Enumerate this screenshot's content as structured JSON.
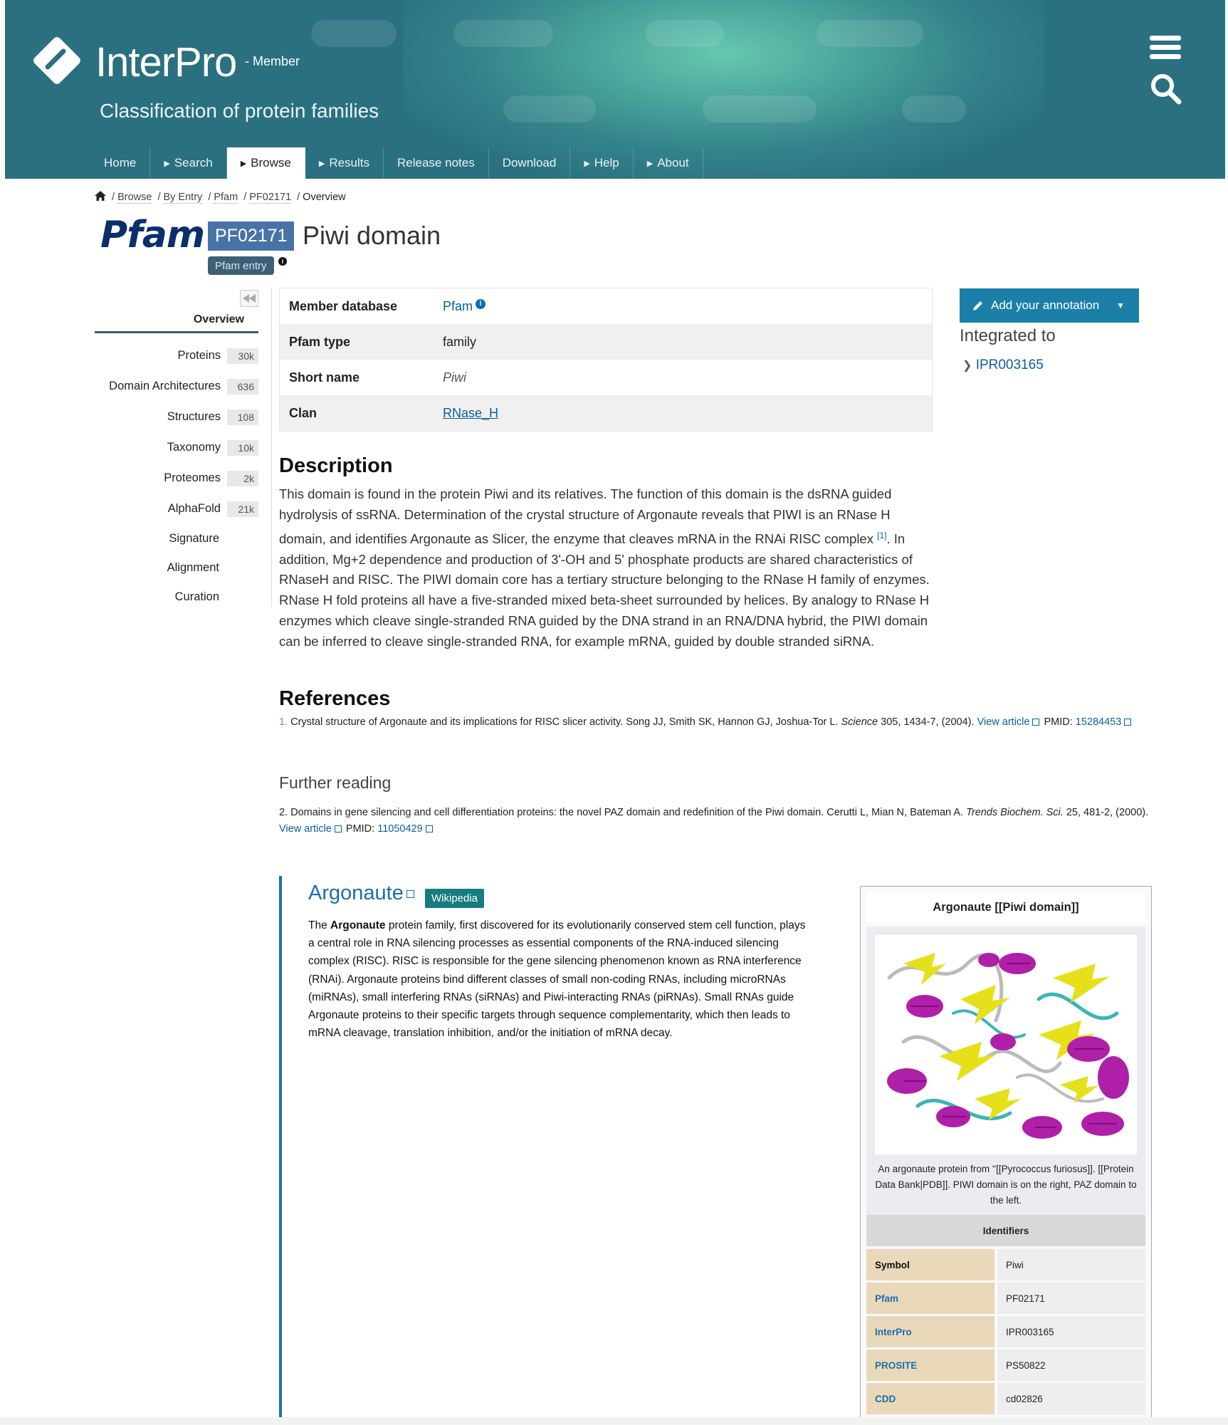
{
  "header": {
    "brand": "InterPro",
    "member_label": "- Member",
    "tagline": "Classification of protein families",
    "nav": [
      {
        "label": "Home",
        "caret": false,
        "active": false
      },
      {
        "label": "Search",
        "caret": true,
        "active": false
      },
      {
        "label": "Browse",
        "caret": true,
        "active": true
      },
      {
        "label": "Results",
        "caret": true,
        "active": false
      },
      {
        "label": "Release notes",
        "caret": false,
        "active": false
      },
      {
        "label": "Download",
        "caret": false,
        "active": false
      },
      {
        "label": "Help",
        "caret": true,
        "active": false
      },
      {
        "label": "About",
        "caret": true,
        "active": false
      }
    ]
  },
  "breadcrumb": [
    "Browse",
    "By Entry",
    "Pfam",
    "PF02171",
    "Overview"
  ],
  "entry": {
    "db_logo_text": "Pfam",
    "accession": "PF02171",
    "title": "Piwi domain",
    "type_badge": "Pfam entry"
  },
  "sidebar": {
    "active": "Overview",
    "items": [
      {
        "label": "Proteins",
        "count": "30k"
      },
      {
        "label": "Domain Architectures",
        "count": "636"
      },
      {
        "label": "Structures",
        "count": "108"
      },
      {
        "label": "Taxonomy",
        "count": "10k"
      },
      {
        "label": "Proteomes",
        "count": "2k"
      },
      {
        "label": "AlphaFold",
        "count": "21k"
      }
    ],
    "plain_items": [
      "Signature",
      "Alignment",
      "Curation"
    ]
  },
  "member_table": [
    {
      "key": "Member database",
      "value": "Pfam"
    },
    {
      "key": "Pfam type",
      "value": "family"
    },
    {
      "key": "Short name",
      "value": "Piwi"
    },
    {
      "key": "Clan",
      "value": "RNase_H"
    }
  ],
  "right": {
    "annotation_button": "Add your annotation",
    "integrated_heading": "Integrated to",
    "integrated_link": "IPR003165"
  },
  "description": {
    "heading": "Description",
    "text_before": "This domain is found in the protein Piwi and its relatives. The function of this domain is the dsRNA guided hydrolysis of ssRNA. Determination of the crystal structure of Argonaute reveals that PIWI is an RNase H domain, and identifies Argonaute as Slicer, the enzyme that cleaves mRNA in the RNAi RISC complex ",
    "citation": "[1]",
    "text_after": ". In addition, Mg+2 dependence and production of 3'-OH and 5' phosphate products are shared characteristics of RNaseH and RISC. The PIWI domain core has a tertiary structure belonging to the RNase H family of enzymes. RNase H fold proteins all have a five-stranded mixed beta-sheet surrounded by helices. By analogy to RNase H enzymes which cleave single-stranded RNA guided by the DNA strand in an RNA/DNA hybrid, the PIWI domain can be inferred to cleave single-stranded RNA, for example mRNA, guided by double stranded siRNA."
  },
  "references": {
    "heading": "References",
    "items": [
      {
        "num": "1.",
        "text": "Crystal structure of Argonaute and its implications for RISC slicer activity. Song JJ, Smith SK, Hannon GJ, Joshua-Tor L.",
        "journal": "Science",
        "details": "305, 1434-7, (2004).",
        "view_label": "View article",
        "pmid_label": "PMID:",
        "pmid": "15284453"
      }
    ]
  },
  "further_reading": {
    "heading": "Further reading",
    "items": [
      {
        "num": "2.",
        "text": "Domains in gene silencing and cell differentiation proteins: the novel PAZ domain and redefinition of the Piwi domain. Cerutti L, Mian N, Bateman A.",
        "journal": "Trends Biochem. Sci.",
        "details": "25, 481-2, (2000).",
        "view_label": "View article",
        "pmid_label": "PMID:",
        "pmid": "11050429"
      }
    ]
  },
  "wikipedia": {
    "title": "Argonaute",
    "badge": "Wikipedia",
    "text_lead": "The ",
    "text_bold": "Argonaute",
    "text_rest": " protein family, first discovered for its evolutionarily conserved stem cell function, plays a central role in RNA silencing processes as essential components of the RNA-induced silencing complex (RISC). RISC is responsible for the gene silencing phenomenon known as RNA interference (RNAi). Argonaute proteins bind different classes of small non-coding RNAs, including microRNAs (miRNAs), small interfering RNAs (siRNAs) and Piwi-interacting RNAs (piRNAs). Small RNAs guide Argonaute proteins to their specific targets through sequence complementarity, which then leads to mRNA cleavage, translation inhibition, and/or the initiation of mRNA decay.",
    "infobox": {
      "title": "Argonaute [[Piwi domain]]",
      "caption": "An argonaute protein from ''[[Pyrococcus furiosus]]. [[Protein Data Bank|PDB]]. PIWI domain is on the right, PAZ domain to the left.",
      "identifiers_heading": "Identifiers",
      "rows": [
        {
          "key": "Symbol",
          "value": "Piwi",
          "link": false
        },
        {
          "key": "Pfam",
          "value": "PF02171",
          "link": true
        },
        {
          "key": "InterPro",
          "value": "IPR003165",
          "link": true
        },
        {
          "key": "PROSITE",
          "value": "PS50822",
          "link": true
        },
        {
          "key": "CDD",
          "value": "cd02826",
          "link": true
        }
      ]
    }
  },
  "colors": {
    "header_bg": "#2a7080",
    "accent_blue": "#1a6fad",
    "accession_badge": "#4873a8",
    "wiki_badge": "#167c80"
  }
}
